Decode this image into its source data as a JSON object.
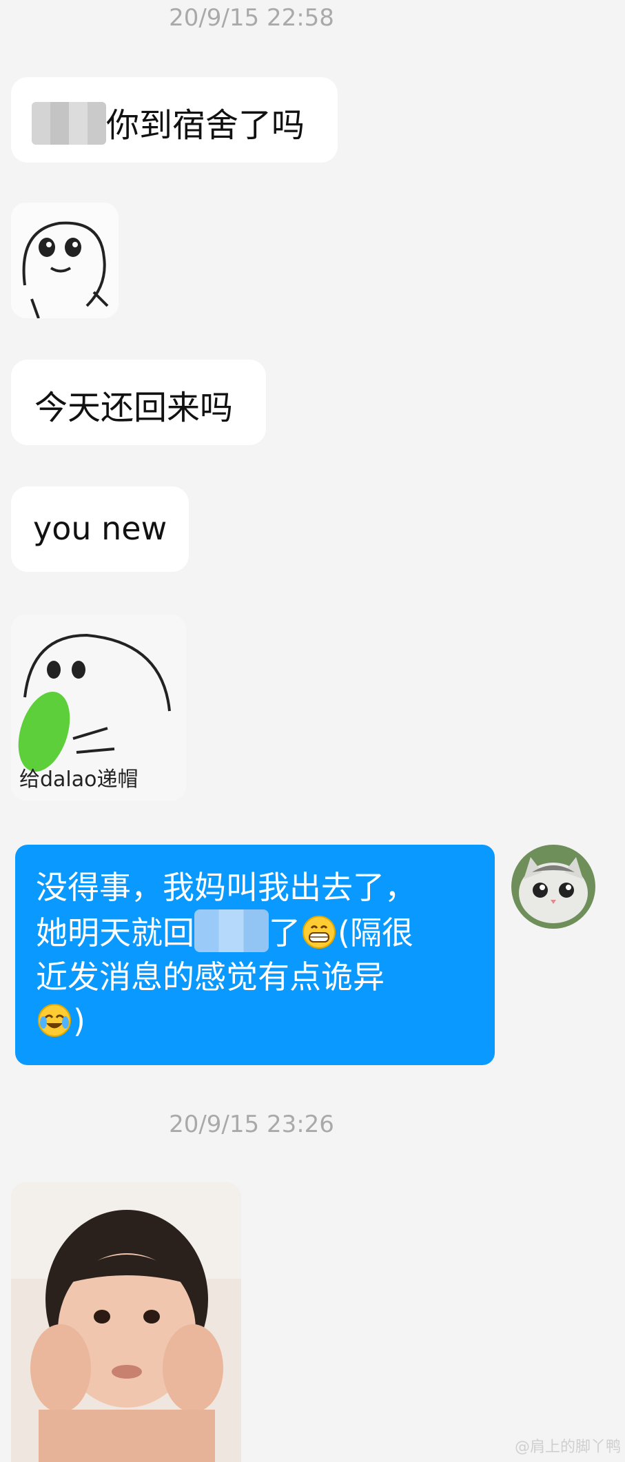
{
  "timestamps": [
    "20/9/15 22:58",
    "20/9/15 23:26"
  ],
  "messages": {
    "m1_text": "你到宿舍了吗",
    "m3_text": "今天还回来吗",
    "m4_text": "you new",
    "sticker2_caption": "给dalao递帽"
  },
  "sent": {
    "line1": "没得事，我妈叫我出去了，",
    "line2a": "她明天就回",
    "line2b": "了",
    "line2c": "(隔很",
    "line3": "近发消息的感觉有点诡异",
    "line4": ")"
  },
  "icons": {
    "grin": "grinning-face-emoji",
    "laugh": "tears-of-joy-emoji",
    "avatar": "cat-avatar"
  },
  "colors": {
    "background": "#f4f4f4",
    "sent_bubble": "#0a99ff",
    "received_bubble": "#ffffff",
    "timestamp": "#a9a9a9"
  },
  "watermark": "@肩上的脚丫鸭"
}
